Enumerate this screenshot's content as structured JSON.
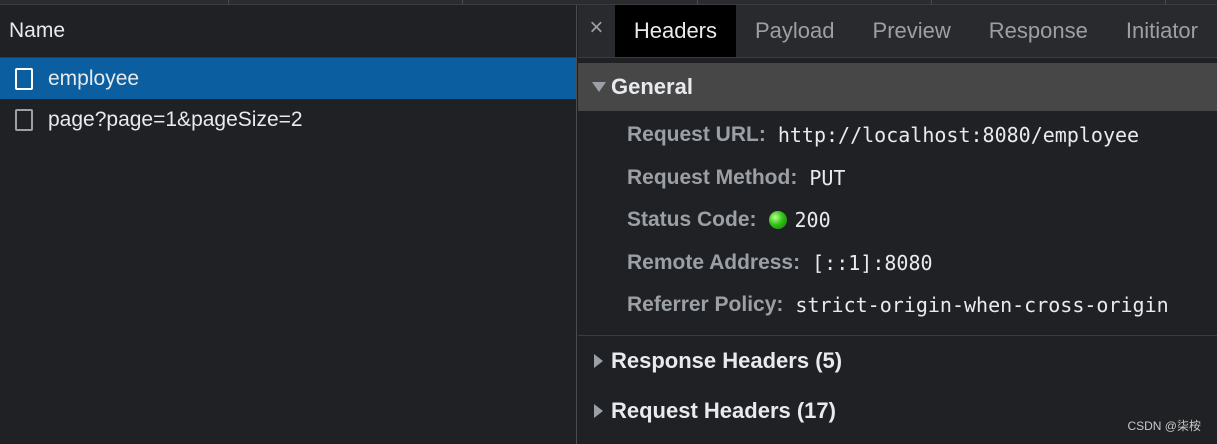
{
  "requests_panel": {
    "column_header": "Name",
    "items": [
      {
        "name": "employee",
        "selected": true
      },
      {
        "name": "page?page=1&pageSize=2",
        "selected": false
      }
    ]
  },
  "detail_panel": {
    "close_glyph": "×",
    "tabs": [
      {
        "label": "Headers",
        "active": true
      },
      {
        "label": "Payload",
        "active": false
      },
      {
        "label": "Preview",
        "active": false
      },
      {
        "label": "Response",
        "active": false
      },
      {
        "label": "Initiator",
        "active": false
      }
    ],
    "general": {
      "title": "General",
      "rows": [
        {
          "key": "Request URL:",
          "value": "http://localhost:8080/employee"
        },
        {
          "key": "Request Method:",
          "value": "PUT"
        },
        {
          "key": "Status Code:",
          "value": "200",
          "status_color": "#31c21a"
        },
        {
          "key": "Remote Address:",
          "value": "[::1]:8080"
        },
        {
          "key": "Referrer Policy:",
          "value": "strict-origin-when-cross-origin"
        }
      ]
    },
    "response_headers": {
      "title": "Response Headers (5)"
    },
    "request_headers": {
      "title": "Request Headers (17)"
    }
  },
  "watermark": "CSDN @柒桉",
  "colors": {
    "selected_row": "#0b5fa0",
    "active_tab_bg": "#000000",
    "general_header_bg": "#474747"
  }
}
